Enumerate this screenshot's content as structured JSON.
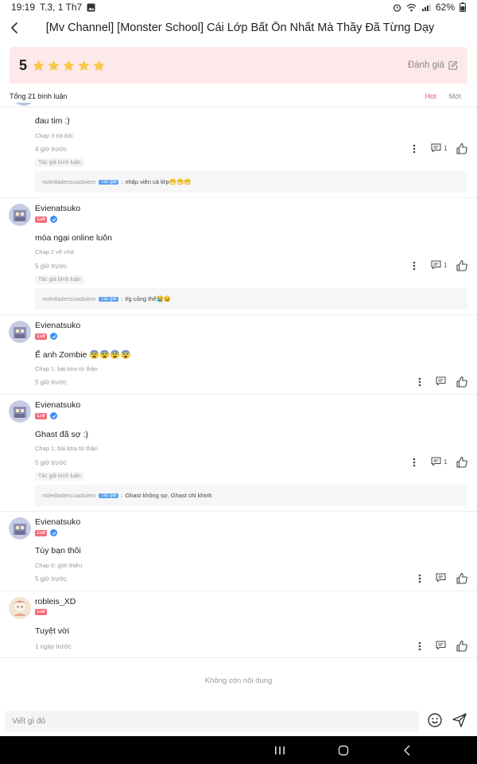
{
  "status_bar": {
    "time": "19:19",
    "date": "T.3, 1 Th7",
    "battery": "62%"
  },
  "header": {
    "title": "[Mv Channel] [Monster School] Cái Lớp Bất Ổn Nhất Mà Thầy Đã Từng Dạy"
  },
  "rating": {
    "score": "5",
    "stars": 5,
    "rate_label": "Đánh giá",
    "star_color": "#f7c94b"
  },
  "comments_summary": {
    "total": "Tổng 21 bình luận",
    "sort_hot": "Hot",
    "sort_new": "Mới"
  },
  "comments": [
    {
      "text": "đau tim :)",
      "chapter": "Chap 3 trả bài",
      "time": "4 giờ trước",
      "reply_count": "1",
      "author_chip": "Tác giả bình luận",
      "reply": {
        "user": "noledadencuadoiem",
        "tag": "Tác giả",
        "sep": ":",
        "text": "nhập viện cả lớp😁😁😁"
      }
    },
    {
      "username": "Evienatsuko",
      "level": "Lv9",
      "text": "móa ngại online luôn",
      "chapter": "Chap 2 về nhà",
      "time": "5 giờ trước",
      "reply_count": "1",
      "author_chip": "Tác giả bình luận",
      "reply": {
        "user": "noledadencuadoiem",
        "tag": "Tác giả",
        "sep": ":",
        "text": "t/g cũng thế😭😖"
      }
    },
    {
      "username": "Evienatsuko",
      "level": "Lv9",
      "text": "Ế anh Zombie 😨😨😨😨",
      "chapter": "Chap 1: bài ktra tử thần",
      "time": "5 giờ trước"
    },
    {
      "username": "Evienatsuko",
      "level": "Lv9",
      "text": "Ghast đã sợ :)",
      "chapter": "Chap 1: bài ktra tử thần",
      "time": "5 giờ trước",
      "reply_count": "1",
      "author_chip": "Tác giả bình luận",
      "reply": {
        "user": "noledadencuadoiem",
        "tag": "Tác giả",
        "sep": ":",
        "text": "Ghast không sợ, Ghast chỉ khinh"
      }
    },
    {
      "username": "Evienatsuko",
      "level": "Lv9",
      "text": "Tùy bạn thôi",
      "chapter": "Chap 0: giới thiệu",
      "time": "5 giờ trước"
    },
    {
      "username": "robleis_XD",
      "level": "Lv6",
      "text": "Tuyệt vời",
      "time": "1 ngày trước"
    }
  ],
  "end_text": "Không còn nội dung",
  "input": {
    "placeholder": "Viết gì đó"
  }
}
